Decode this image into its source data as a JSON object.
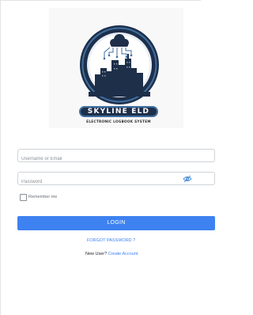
{
  "brand": {
    "name": "SKYLINE ELD",
    "tagline": "ELECTRONIC LOGBOOK SYSTEM",
    "colors": {
      "navy": "#1e2f4a",
      "steel_blue": "#3f6fa1",
      "accent_blue": "#3d82f0"
    }
  },
  "login_form": {
    "username_placeholder": "Username or Email",
    "password_placeholder": "Password",
    "password_toggle_icon": "eye-slash-icon",
    "remember_me_label": "Remember me",
    "remember_me_checked": false,
    "login_button_label": "LOGIN",
    "forgot_password_label": "FORGOT PASSWORD ?",
    "new_user_prefix": "New User?",
    "create_account_label": "Create Account"
  }
}
